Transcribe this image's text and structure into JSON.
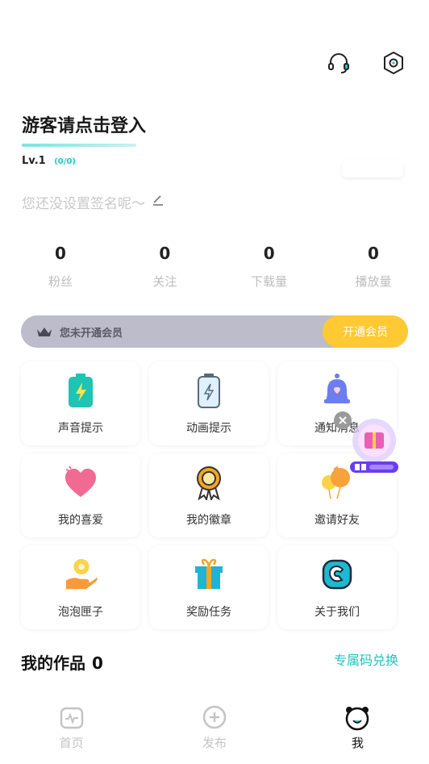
{
  "header": {
    "icons": [
      "headset-icon",
      "settings-icon"
    ]
  },
  "profile": {
    "login_prompt": "游客请点击登入",
    "level": "Lv.1",
    "level_progress": "(0/0)",
    "signature": "您还没设置签名呢～"
  },
  "stats": [
    {
      "value": "0",
      "label": "粉丝"
    },
    {
      "value": "0",
      "label": "关注"
    },
    {
      "value": "0",
      "label": "下载量"
    },
    {
      "value": "0",
      "label": "播放量"
    }
  ],
  "vip": {
    "status": "您未开通会员",
    "button": "开通会员"
  },
  "menu": [
    {
      "label": "声音提示",
      "icon": "battery-sound-icon"
    },
    {
      "label": "动画提示",
      "icon": "battery-animation-icon"
    },
    {
      "label": "通知消息",
      "icon": "bell-icon"
    },
    {
      "label": "我的喜爱",
      "icon": "heart-icon"
    },
    {
      "label": "我的徽章",
      "icon": "badge-medal-icon"
    },
    {
      "label": "邀请好友",
      "icon": "balloons-icon"
    },
    {
      "label": "泡泡匣子",
      "icon": "hand-coin-icon"
    },
    {
      "label": "奖励任务",
      "icon": "gift-icon"
    },
    {
      "label": "关于我们",
      "icon": "app-logo-icon"
    }
  ],
  "works": {
    "title": "我的作品",
    "count": "0",
    "redeem": "专属码兑换"
  },
  "tabs": [
    {
      "label": "首页",
      "icon": "home-pulse-icon"
    },
    {
      "label": "发布",
      "icon": "plus-circle-icon"
    },
    {
      "label": "我",
      "icon": "bear-face-icon"
    }
  ],
  "colors": {
    "accent": "#22c2c0",
    "vip_button": "#ffc933",
    "vip_bar": "#bcbccb"
  }
}
